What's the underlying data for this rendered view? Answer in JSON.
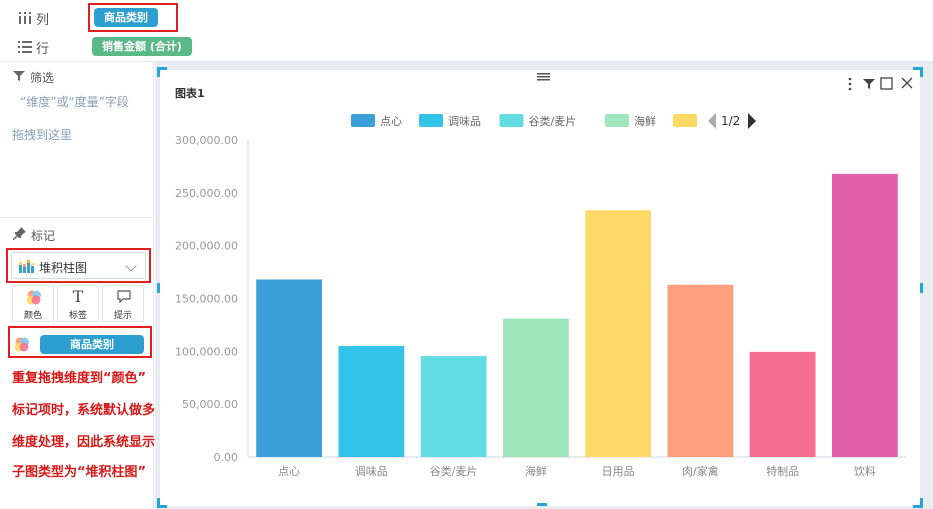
{
  "shelves": {
    "columns": {
      "label": "列",
      "pill": "商品类别"
    },
    "rows": {
      "label": "行",
      "pill": "销售金额 (合计)"
    }
  },
  "filter": {
    "title": "筛选",
    "hint_line1": "“维度”或“度量”字段",
    "hint_line2": "拖拽到这里"
  },
  "marks": {
    "title": "标记",
    "chart_type": "堆积柱图",
    "buttons": {
      "color": "颜色",
      "label": "标签",
      "tooltip": "提示"
    },
    "color_pill": "商品类别"
  },
  "annotation": {
    "line1": "重复拖拽维度到“颜色”",
    "line2": "标记项时，系统默认做多",
    "line3": "维度处理，因此系统显示",
    "line4": "子图类型为“堆积柱图”"
  },
  "colors": {
    "accent": "#27a3d8",
    "annotation": "#d41919",
    "pill_blue": "#2a9fd0",
    "pill_green": "#5ab889"
  },
  "chart_data": {
    "type": "bar",
    "title": "图表1",
    "categories": [
      "点心",
      "调味品",
      "谷类/麦片",
      "海鲜",
      "日用品",
      "肉/家禽",
      "特制品",
      "饮料"
    ],
    "values": [
      168000,
      105000,
      95500,
      131000,
      233500,
      163000,
      99500,
      268000
    ],
    "colors": [
      "#3ba0da",
      "#32c3e8",
      "#62dce3",
      "#9fe6bc",
      "#ffd966",
      "#ff9e7d",
      "#f66f8e",
      "#e060aa"
    ],
    "ylim": [
      0,
      300000
    ],
    "yticks": [
      "0.00",
      "50,000.00",
      "100,000.00",
      "150,000.00",
      "200,000.00",
      "250,000.00",
      "300,000.00"
    ],
    "legend": {
      "position": "top",
      "items": [
        "点心",
        "调味品",
        "谷类/麦片",
        "海鲜",
        ""
      ],
      "page": "1/2"
    },
    "grid": false
  }
}
